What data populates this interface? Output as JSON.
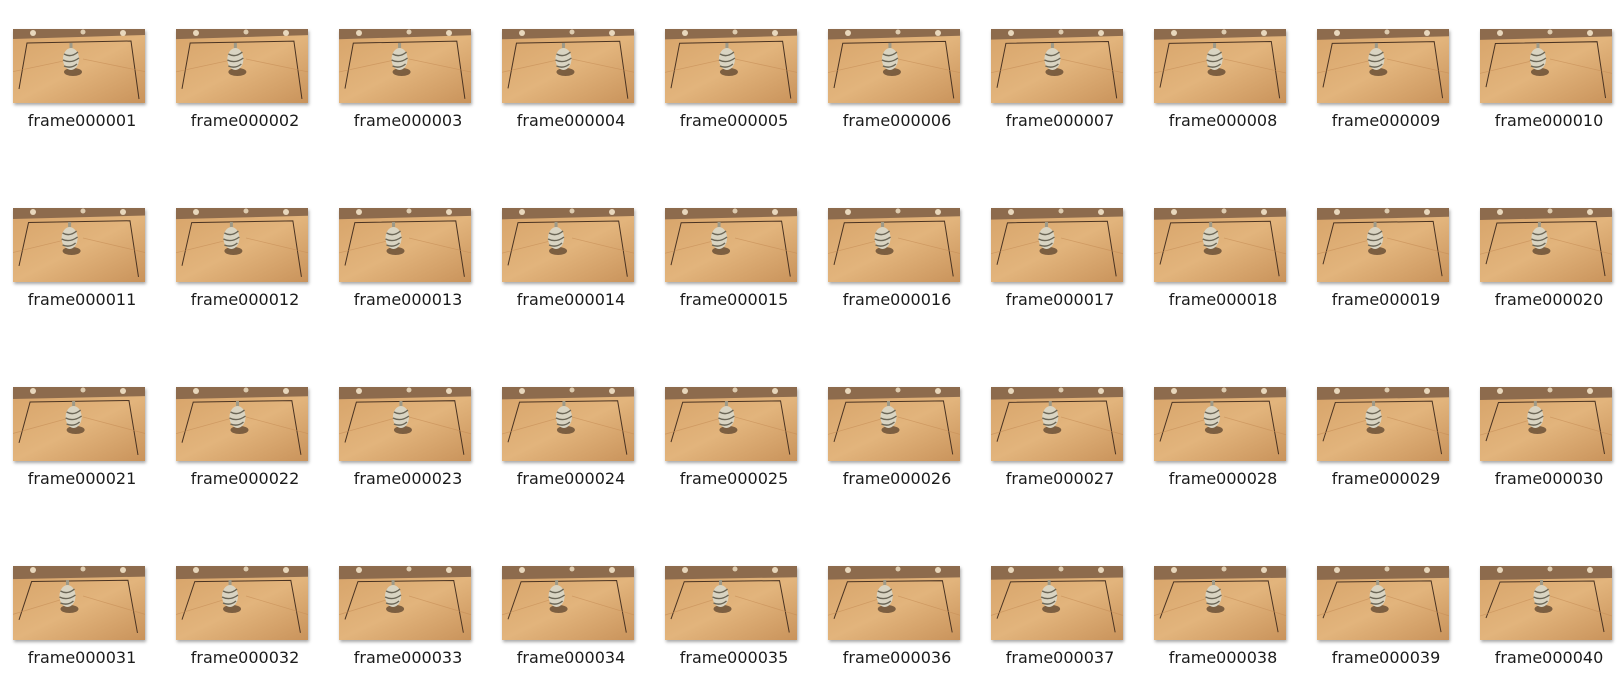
{
  "thumbnail_icon": "vase-on-wood-floor-photo",
  "files": [
    {
      "name": "frame000001"
    },
    {
      "name": "frame000002"
    },
    {
      "name": "frame000003"
    },
    {
      "name": "frame000004"
    },
    {
      "name": "frame000005"
    },
    {
      "name": "frame000006"
    },
    {
      "name": "frame000007"
    },
    {
      "name": "frame000008"
    },
    {
      "name": "frame000009"
    },
    {
      "name": "frame000010"
    },
    {
      "name": "frame000011"
    },
    {
      "name": "frame000012"
    },
    {
      "name": "frame000013"
    },
    {
      "name": "frame000014"
    },
    {
      "name": "frame000015"
    },
    {
      "name": "frame000016"
    },
    {
      "name": "frame000017"
    },
    {
      "name": "frame000018"
    },
    {
      "name": "frame000019"
    },
    {
      "name": "frame000020"
    },
    {
      "name": "frame000021"
    },
    {
      "name": "frame000022"
    },
    {
      "name": "frame000023"
    },
    {
      "name": "frame000024"
    },
    {
      "name": "frame000025"
    },
    {
      "name": "frame000026"
    },
    {
      "name": "frame000027"
    },
    {
      "name": "frame000028"
    },
    {
      "name": "frame000029"
    },
    {
      "name": "frame000030"
    },
    {
      "name": "frame000031"
    },
    {
      "name": "frame000032"
    },
    {
      "name": "frame000033"
    },
    {
      "name": "frame000034"
    },
    {
      "name": "frame000035"
    },
    {
      "name": "frame000036"
    },
    {
      "name": "frame000037"
    },
    {
      "name": "frame000038"
    },
    {
      "name": "frame000039"
    },
    {
      "name": "frame000040"
    }
  ]
}
